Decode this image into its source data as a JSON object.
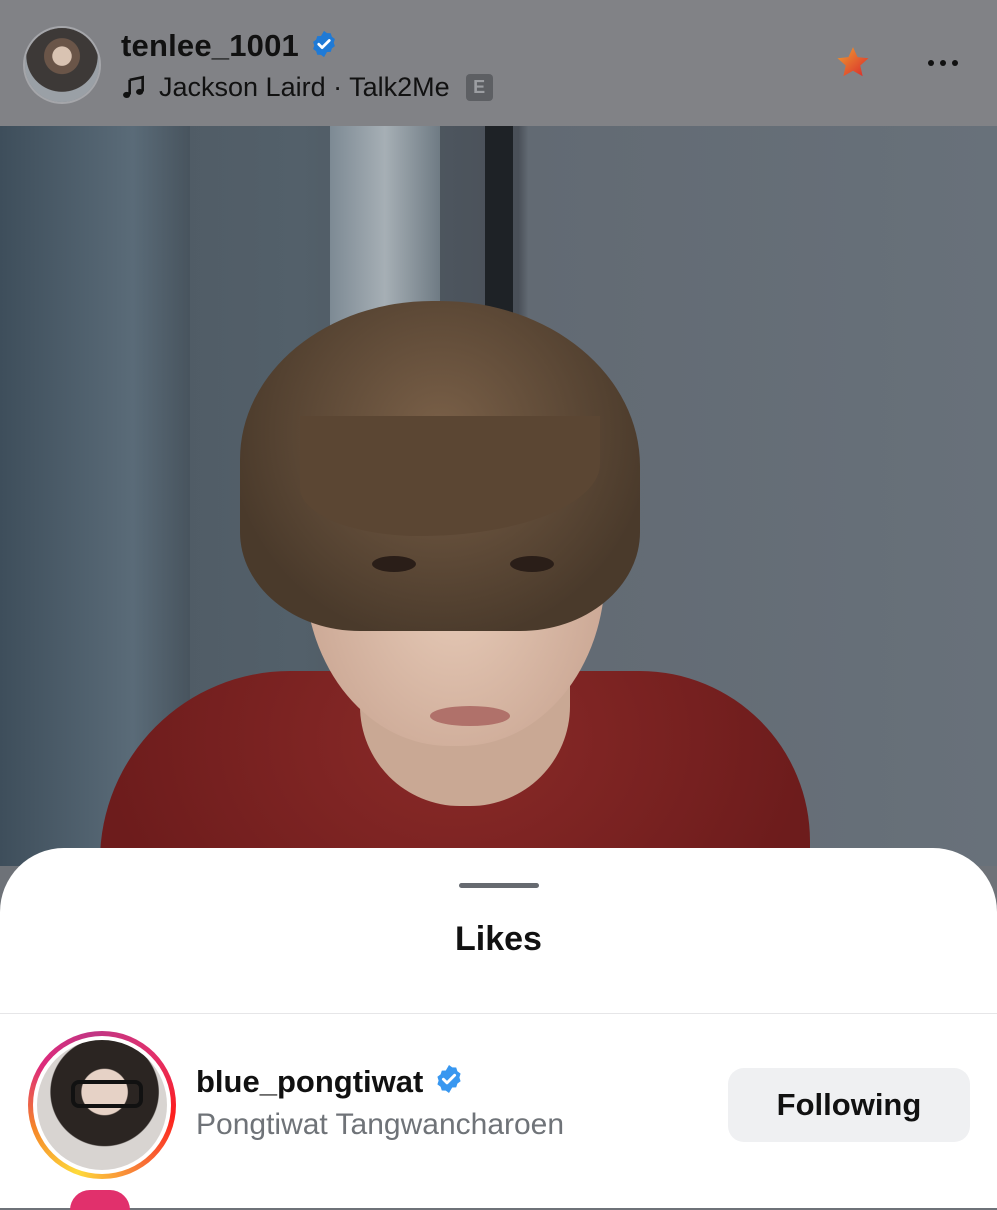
{
  "header": {
    "username": "tenlee_1001",
    "verified_icon": "verified-badge-icon",
    "music_icon": "music-note-icon",
    "music_text": "Jackson Laird · Talk2Me",
    "explicit_label": "E",
    "star_icon": "favorite-star-icon",
    "more_icon": "more-options-icon",
    "colors": {
      "verified": "#3897f0",
      "star_from": "#f0a030",
      "star_to": "#d8282c"
    }
  },
  "likes_sheet": {
    "title": "Likes",
    "items": [
      {
        "username": "blue_pongtiwat",
        "verified": true,
        "full_name": "Pongtiwat Tangwancharoen",
        "button_label": "Following",
        "has_story_ring": true
      }
    ]
  }
}
